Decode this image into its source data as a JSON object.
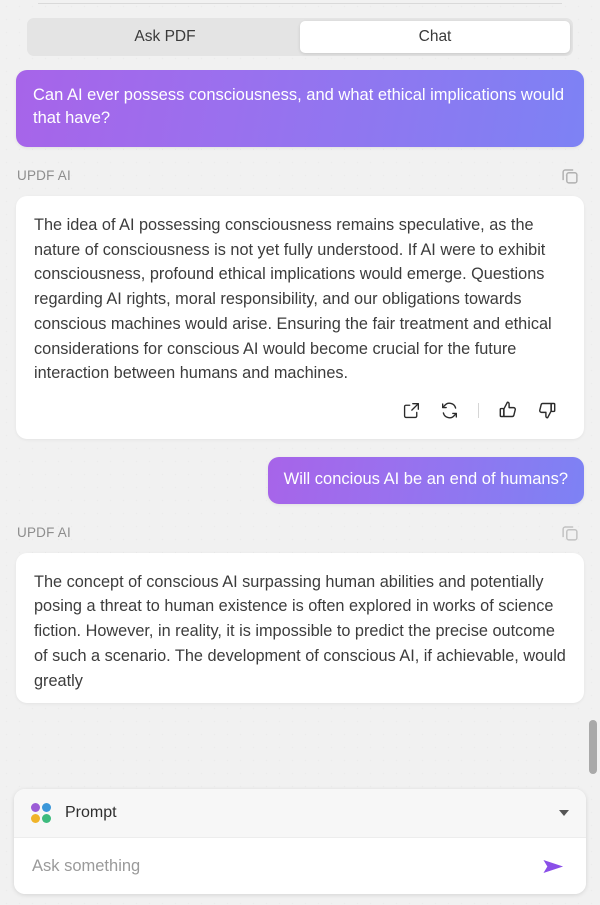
{
  "tabs": {
    "ask_pdf_label": "Ask PDF",
    "chat_label": "Chat",
    "active": "Chat"
  },
  "conversation": [
    {
      "role": "user",
      "text": "Can AI ever possess consciousness, and what ethical implications would that have?"
    },
    {
      "role": "assistant",
      "sender_label": "UPDF AI",
      "text": "The idea of AI possessing consciousness remains speculative, as the nature of consciousness is not yet fully understood. If AI were to exhibit consciousness, profound ethical implications would emerge. Questions regarding AI rights, moral responsibility, and our obligations towards conscious machines would arise. Ensuring the fair treatment and ethical considerations for conscious AI would become crucial for the future interaction between humans and machines."
    },
    {
      "role": "user",
      "text": "Will concious AI be an end of humans?"
    },
    {
      "role": "assistant",
      "sender_label": "UPDF AI",
      "text": "The concept of conscious AI surpassing human abilities and potentially posing a threat to human existence is often explored in works of science fiction. However, in reality, it is impossible to predict the precise outcome of such a scenario. The development of conscious AI, if achievable, would greatly"
    }
  ],
  "icons": {
    "copy": "copy-icon",
    "share": "external-link-icon",
    "regenerate": "refresh-icon",
    "like": "thumbs-up-icon",
    "dislike": "thumbs-down-icon",
    "prompt": "four-dots-icon",
    "dropdown": "chevron-down-icon",
    "send": "send-icon"
  },
  "composer": {
    "prompt_label": "Prompt",
    "input_value": "",
    "input_placeholder": "Ask something"
  },
  "colors": {
    "bubble_gradient_start": "#a764e9",
    "bubble_gradient_end": "#7d82f4",
    "send_arrow": "#8a4fe8",
    "dot_purple": "#9b5cd6",
    "dot_blue": "#3b97d9",
    "dot_orange": "#f0b429",
    "dot_green": "#3dbb7e",
    "background": "#f1f1f1",
    "card": "#ffffff"
  }
}
